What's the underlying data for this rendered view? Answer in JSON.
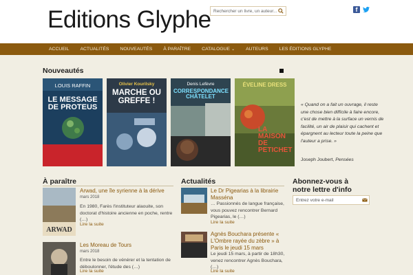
{
  "header": {
    "logo": "Editions Glyphe",
    "search_placeholder": "Rechercher un livre, un auteur..."
  },
  "nav": [
    {
      "label": "ACCUEIL"
    },
    {
      "label": "ACTUALITÉS"
    },
    {
      "label": "NOUVEAUTÉS"
    },
    {
      "label": "À PARAÎTRE"
    },
    {
      "label": "CATALOGUE"
    },
    {
      "label": "AUTEURS"
    },
    {
      "label": "LES ÉDITIONS GLYPHE"
    }
  ],
  "nouveautes": {
    "title": "Nouveautés",
    "books": [
      {
        "author": "LOUIS RAFFIN",
        "title": "LE MESSAGE DE PROTEUS",
        "color": "#c9242b"
      },
      {
        "author": "Olivier Kourilsky",
        "title": "MARCHE OU GREFFE !",
        "color": "#2d3a48"
      },
      {
        "author": "Denis Lefèvre",
        "title": "CORRESPONDANCE CHÂTELET",
        "color": "#3b5a6a"
      },
      {
        "author": "ÉVELINE DRESS",
        "title": "LA MAISON DE PETICHET",
        "color": "#6a7a3a"
      }
    ]
  },
  "quote": {
    "text": "« Quand on a fait un ouvrage, il reste une chose bien difficile à faire encore, c'est de mettre à la surface un vernis de facilité, un air de plaisir qui cachent et épargnent au lecteur toute la peine que l'auteur a prise. »",
    "author": "Joseph Joubert,",
    "source": "Pensées"
  },
  "a_paraitre": {
    "title": "À paraître",
    "articles": [
      {
        "title": "Arwad, une île syrienne à la dérive",
        "date": "mars 2018",
        "excerpt": "En 1980, Farès l'instituteur alaouite, son doctorat d'histoire ancienne en poche, rentre (…)",
        "more": "Lire la suite"
      },
      {
        "title": "Les Moreau de Tours",
        "date": "mars 2018",
        "excerpt": "Entre le besoin de vénérer et la tentation de déboulonner, l'étude des (…)",
        "more": "Lire la suite"
      }
    ]
  },
  "actualites": {
    "title": "Actualités",
    "articles": [
      {
        "title": "Le Dr Pigearias à la librairie Masséna",
        "date": "",
        "excerpt": "… Passionnés de langue française, vous pouvez rencontrer Bernard Pigearias, le (…)",
        "more": "Lire la suite"
      },
      {
        "title": "Agnès Bouchara présente « L'Ombre rayée du zèbre » à Paris le jeudi 15 mars",
        "date": "",
        "excerpt": "Le jeudi 15 mars, à partir de 18h30, venez rencontrer Agnès Bouchara, (…)",
        "more": "Lire la suite"
      }
    ]
  },
  "newsletter": {
    "title": "Abonnez-vous à notre lettre d'info",
    "placeholder": "Entrez votre e-mail"
  }
}
